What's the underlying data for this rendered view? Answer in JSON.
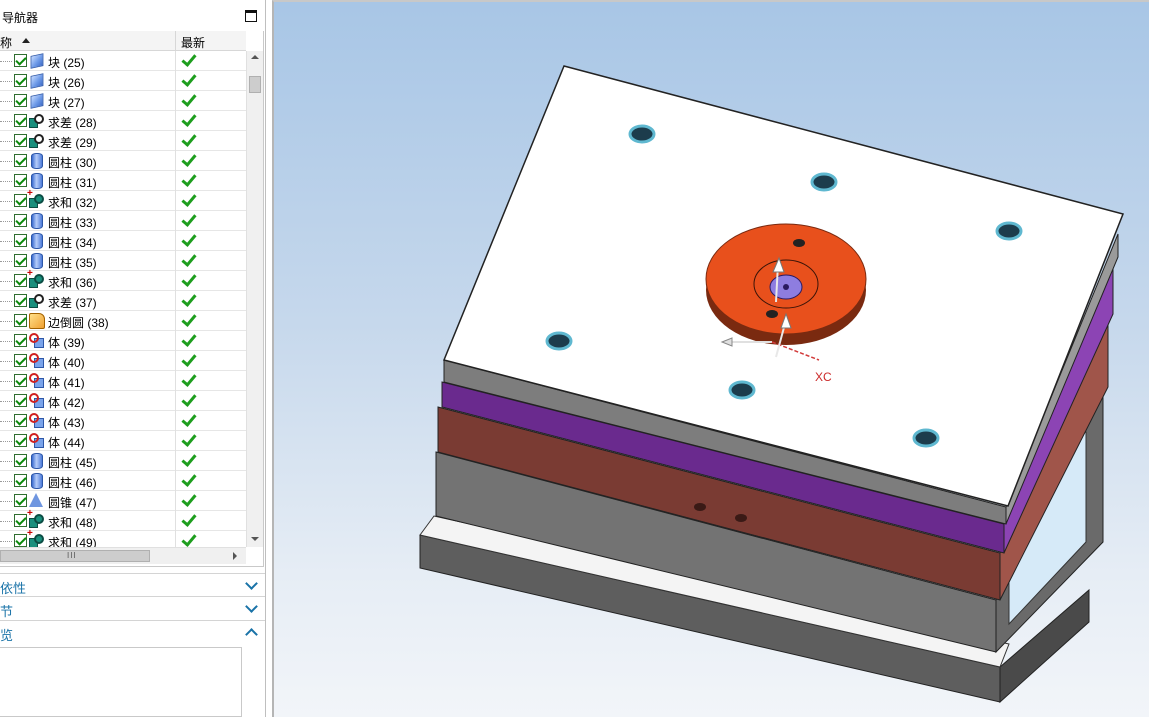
{
  "navigator": {
    "title": "导航器",
    "column_name": "称",
    "column_latest": "最新",
    "items": [
      {
        "label": "块 (25)",
        "icon": "block-icon"
      },
      {
        "label": "块 (26)",
        "icon": "block-icon"
      },
      {
        "label": "块 (27)",
        "icon": "block-icon"
      },
      {
        "label": "求差 (28)",
        "icon": "subtract-icon"
      },
      {
        "label": "求差 (29)",
        "icon": "subtract-icon"
      },
      {
        "label": "圆柱 (30)",
        "icon": "cylinder-icon"
      },
      {
        "label": "圆柱 (31)",
        "icon": "cylinder-icon"
      },
      {
        "label": "求和 (32)",
        "icon": "unite-icon"
      },
      {
        "label": "圆柱 (33)",
        "icon": "cylinder-icon"
      },
      {
        "label": "圆柱 (34)",
        "icon": "cylinder-icon"
      },
      {
        "label": "圆柱 (35)",
        "icon": "cylinder-icon"
      },
      {
        "label": "求和 (36)",
        "icon": "unite-icon"
      },
      {
        "label": "求差 (37)",
        "icon": "subtract-icon"
      },
      {
        "label": "边倒圆 (38)",
        "icon": "edge-blend-icon"
      },
      {
        "label": "体 (39)",
        "icon": "body-icon"
      },
      {
        "label": "体 (40)",
        "icon": "body-icon"
      },
      {
        "label": "体 (41)",
        "icon": "body-icon"
      },
      {
        "label": "体 (42)",
        "icon": "body-icon"
      },
      {
        "label": "体 (43)",
        "icon": "body-icon"
      },
      {
        "label": "体 (44)",
        "icon": "body-icon"
      },
      {
        "label": "圆柱 (45)",
        "icon": "cylinder-icon"
      },
      {
        "label": "圆柱 (46)",
        "icon": "cylinder-icon"
      },
      {
        "label": "圆锥 (47)",
        "icon": "cone-icon"
      },
      {
        "label": "求和 (48)",
        "icon": "unite-icon"
      },
      {
        "label": "求和 (49)",
        "icon": "unite-icon"
      }
    ],
    "scroll_grip": "III",
    "sections": {
      "dependencies": "依性",
      "details": "节",
      "preview": "览"
    }
  },
  "viewport": {
    "axis_label": "XC"
  },
  "colors": {
    "status_check": "#1e9e1e",
    "section_text": "#1a73a8",
    "locating_ring": "#e8501c",
    "plate_purple": "#6a2a8e",
    "plate_brown": "#7a3b33",
    "plate_top": "#ffffff"
  }
}
